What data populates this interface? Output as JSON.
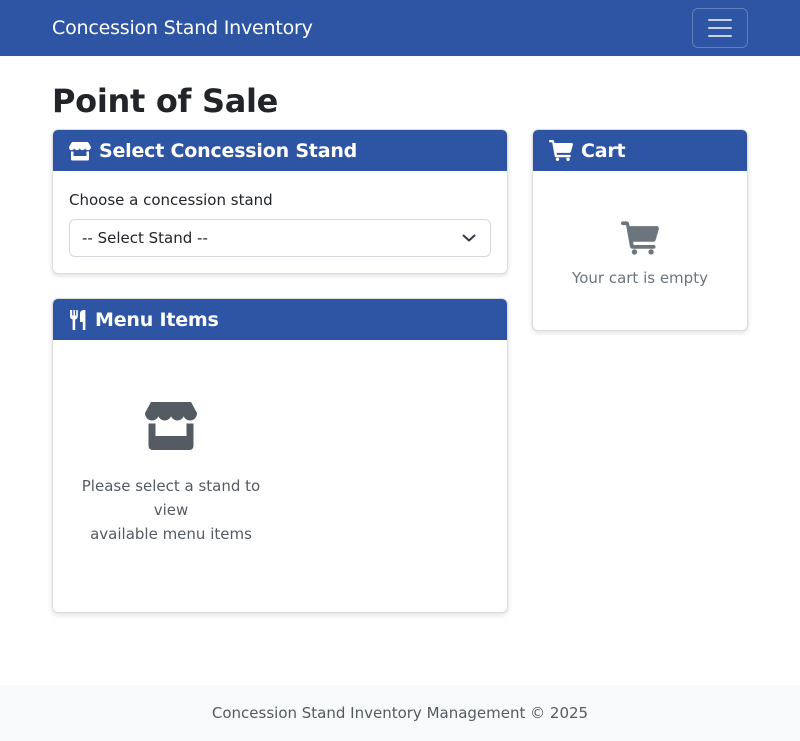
{
  "navbar": {
    "brand": "Concession Stand Inventory",
    "toggle_icon": "menu-icon"
  },
  "page": {
    "title": "Point of Sale"
  },
  "stand_card": {
    "title": "Select Concession Stand",
    "icon": "store-icon",
    "field_label": "Choose a concession stand",
    "select_value": "-- Select Stand --"
  },
  "menu_card": {
    "title": "Menu Items",
    "icon": "utensils-icon",
    "empty_line1": "Please select a stand to view",
    "empty_line2": "available menu items"
  },
  "cart_card": {
    "title": "Cart",
    "icon": "cart-icon",
    "empty_text": "Your cart is empty"
  },
  "footer": {
    "text": "Concession Stand Inventory Management © 2025"
  },
  "colors": {
    "primary": "#2d55a3",
    "muted_text": "#6c757d",
    "footer_bg": "#f8f9fa"
  }
}
